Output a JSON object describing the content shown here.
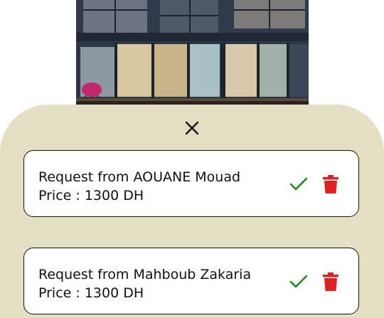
{
  "hero_image": {
    "subject": "modern house at dusk"
  },
  "sheet": {
    "close_icon": "close-icon"
  },
  "requests": [
    {
      "title": "Request from AOUANE Mouad",
      "price": "Price : 1300 DH"
    },
    {
      "title": "Request from Mahboub Zakaria",
      "price": "Price : 1300 DH"
    }
  ],
  "colors": {
    "sheet_bg": "#e3dfc2",
    "accept": "#1e8a1e",
    "delete": "#e02020"
  }
}
